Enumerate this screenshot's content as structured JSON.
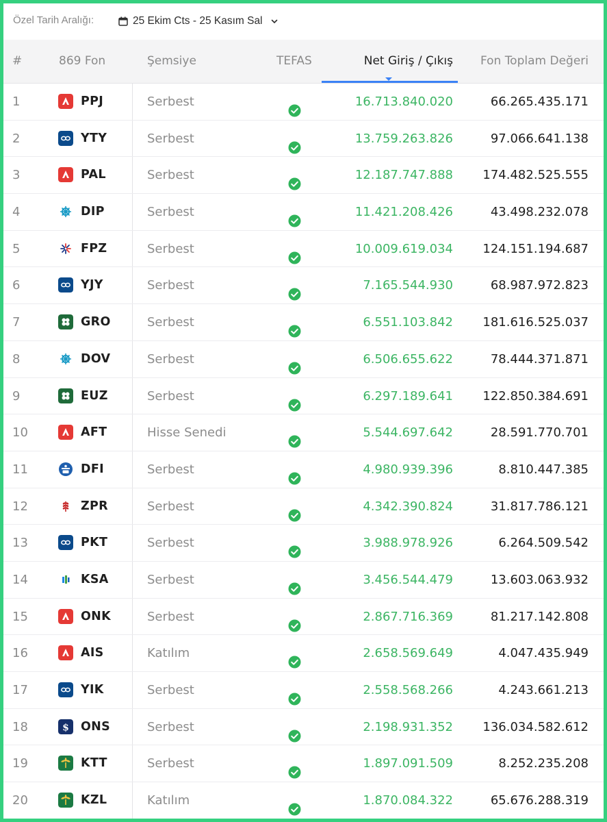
{
  "filter": {
    "label": "Özel Tarih Aralığı:",
    "range": "25 Ekim Cts - 25 Kasım Sal",
    "calendar_icon": "calendar-icon",
    "chevron_icon": "chevron-down-icon"
  },
  "columns": {
    "rank": "#",
    "fund": "869 Fon",
    "category": "Şemsiye",
    "tefas": "TEFAS",
    "net_flow": "Net Giriş / Çıkış",
    "total_value": "Fon Toplam Değeri"
  },
  "sorted_column": "net_flow",
  "colors": {
    "positive": "#3cb563",
    "sort_accent": "#3b82f6",
    "frame": "#35d07f",
    "check": "#2fb45a"
  },
  "rows": [
    {
      "rank": "1",
      "code": "PPJ",
      "logo": "red-a-logo",
      "category": "Serbest",
      "tefas": true,
      "net": "16.713.840.020",
      "total": "66.265.435.171"
    },
    {
      "rank": "2",
      "code": "YTY",
      "logo": "blue-wave-logo",
      "category": "Serbest",
      "tefas": true,
      "net": "13.759.263.826",
      "total": "97.066.641.138"
    },
    {
      "rank": "3",
      "code": "PAL",
      "logo": "red-a-logo",
      "category": "Serbest",
      "tefas": true,
      "net": "12.187.747.888",
      "total": "174.482.525.555"
    },
    {
      "rank": "4",
      "code": "DIP",
      "logo": "teal-wheel-logo",
      "category": "Serbest",
      "tefas": true,
      "net": "11.421.208.426",
      "total": "43.498.232.078"
    },
    {
      "rank": "5",
      "code": "FPZ",
      "logo": "starburst-logo",
      "category": "Serbest",
      "tefas": true,
      "net": "10.009.619.034",
      "total": "124.151.194.687"
    },
    {
      "rank": "6",
      "code": "YJY",
      "logo": "blue-wave-logo",
      "category": "Serbest",
      "tefas": true,
      "net": "7.165.544.930",
      "total": "68.987.972.823"
    },
    {
      "rank": "7",
      "code": "GRO",
      "logo": "green-clover-logo",
      "category": "Serbest",
      "tefas": true,
      "net": "6.551.103.842",
      "total": "181.616.525.037"
    },
    {
      "rank": "8",
      "code": "DOV",
      "logo": "teal-wheel-logo",
      "category": "Serbest",
      "tefas": true,
      "net": "6.506.655.622",
      "total": "78.444.371.871"
    },
    {
      "rank": "9",
      "code": "EUZ",
      "logo": "green-clover-logo",
      "category": "Serbest",
      "tefas": true,
      "net": "6.297.189.641",
      "total": "122.850.384.691"
    },
    {
      "rank": "10",
      "code": "AFT",
      "logo": "red-a-logo",
      "category": "Hisse Senedi",
      "tefas": true,
      "net": "5.544.697.642",
      "total": "28.591.770.701"
    },
    {
      "rank": "11",
      "code": "DFI",
      "logo": "blue-stack-logo",
      "category": "Serbest",
      "tefas": true,
      "net": "4.980.939.396",
      "total": "8.810.447.385"
    },
    {
      "rank": "12",
      "code": "ZPR",
      "logo": "red-wheat-logo",
      "category": "Serbest",
      "tefas": true,
      "net": "4.342.390.824",
      "total": "31.817.786.121"
    },
    {
      "rank": "13",
      "code": "PKT",
      "logo": "blue-wave-logo",
      "category": "Serbest",
      "tefas": true,
      "net": "3.988.978.926",
      "total": "6.264.509.542"
    },
    {
      "rank": "14",
      "code": "KSA",
      "logo": "bars-logo",
      "category": "Serbest",
      "tefas": true,
      "net": "3.456.544.479",
      "total": "13.603.063.932"
    },
    {
      "rank": "15",
      "code": "ONK",
      "logo": "red-a-logo",
      "category": "Serbest",
      "tefas": true,
      "net": "2.867.716.369",
      "total": "81.217.142.808"
    },
    {
      "rank": "16",
      "code": "AIS",
      "logo": "red-a-logo",
      "category": "Katılım",
      "tefas": true,
      "net": "2.658.569.649",
      "total": "4.047.435.949"
    },
    {
      "rank": "17",
      "code": "YIK",
      "logo": "blue-wave-logo",
      "category": "Serbest",
      "tefas": true,
      "net": "2.558.568.266",
      "total": "4.243.661.213"
    },
    {
      "rank": "18",
      "code": "ONS",
      "logo": "navy-dollar-logo",
      "category": "Serbest",
      "tefas": true,
      "net": "2.198.931.352",
      "total": "136.034.582.612"
    },
    {
      "rank": "19",
      "code": "KTT",
      "logo": "green-palm-logo",
      "category": "Serbest",
      "tefas": true,
      "net": "1.897.091.509",
      "total": "8.252.235.208"
    },
    {
      "rank": "20",
      "code": "KZL",
      "logo": "green-palm-logo",
      "category": "Katılım",
      "tefas": true,
      "net": "1.870.084.322",
      "total": "65.676.288.319"
    }
  ]
}
